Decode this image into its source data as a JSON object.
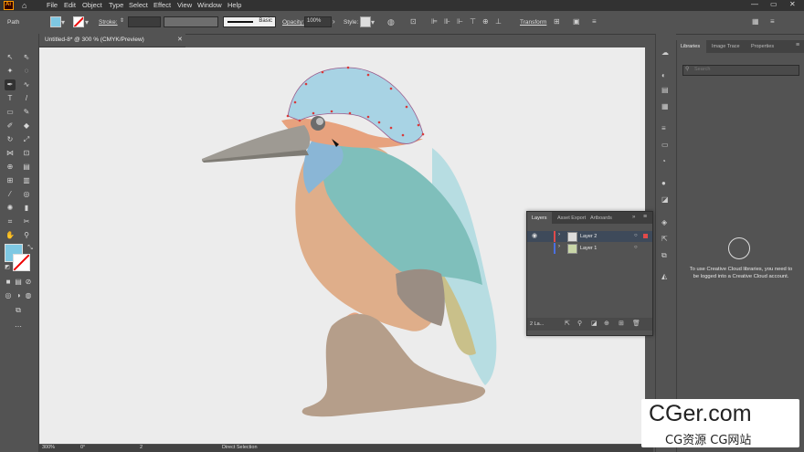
{
  "menubar": {
    "app_icon": "Ai",
    "home_icon": "home-icon",
    "items": [
      "File",
      "Edit",
      "Object",
      "Type",
      "Select",
      "Effect",
      "View",
      "Window",
      "Help"
    ]
  },
  "control": {
    "selection_type": "Path",
    "stroke_label": "Stroke:",
    "brush_label": "Basic",
    "opacity_label": "Opacity:",
    "opacity_value": "100%",
    "style_label": "Style:",
    "transform_label": "Transform"
  },
  "document": {
    "tab_title": "Untitled-8* @ 300 % (CMYK/Preview)",
    "zoom": "300%",
    "rotation": "0°",
    "artboard_num": "2",
    "status_text": "Direct Selection"
  },
  "layers_panel": {
    "tabs": [
      "Layers",
      "Asset Export",
      "Artboards"
    ],
    "layers": [
      {
        "name": "Layer 2",
        "color": "#e04a4a"
      },
      {
        "name": "Layer 1",
        "color": "#4a6fe0"
      }
    ],
    "footer_count": "2 La..."
  },
  "libraries_panel": {
    "tabs": [
      "Libraries",
      "Image Trace",
      "Properties"
    ],
    "search_placeholder": "Search",
    "message": "To use Creative Cloud libraries, you need to be logged into a Creative Cloud account."
  },
  "watermark": {
    "line1": "CGer.com",
    "line2": "CG资源 CG网站"
  },
  "colors": {
    "fill": "#7ec8e3",
    "accent": "#1a73e8",
    "canvas": "#ececec"
  }
}
